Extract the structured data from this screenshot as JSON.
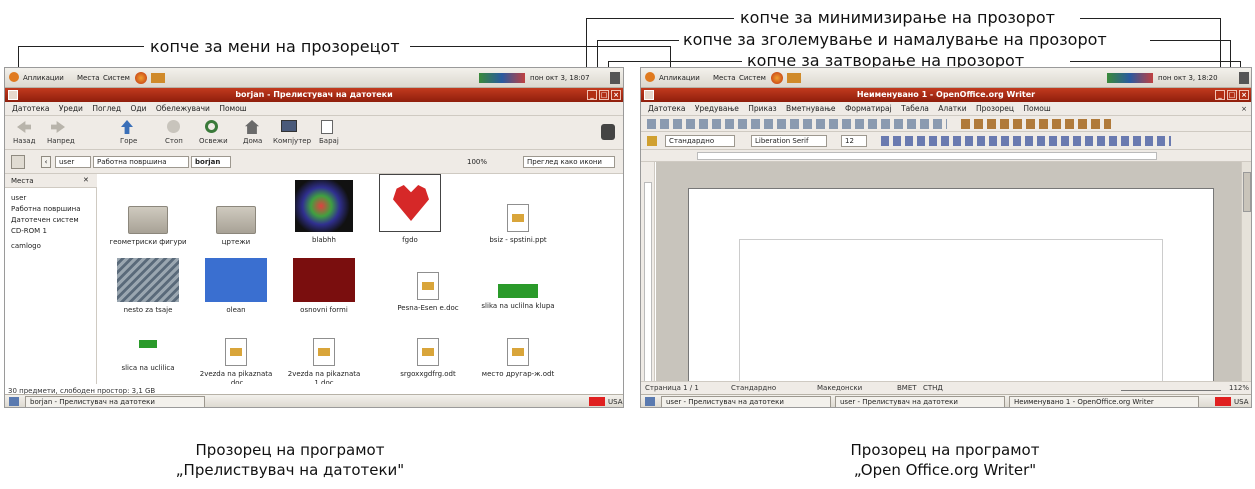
{
  "annotations": {
    "window_menu_button": "копче за мени на прозорецот",
    "minimize_button": "копче за минимизирање на прозорот",
    "maximize_button": "копче за зголемување и намалување на прозорот",
    "close_button": "копче за затворање на прозорот"
  },
  "captions": {
    "left_line1": "Прозорец на програмот",
    "left_line2": "„Прелиствувач на датотеки\"",
    "right_line1": "Прозорец на програмот",
    "right_line2": "„Open Office.org Writer\""
  },
  "gnome_panel": {
    "applications": "Апликации",
    "places": "Места",
    "system": "Систем",
    "clock": "пон окт 3, 18:07",
    "clock_right": "пон окт 3, 18:20"
  },
  "file_browser": {
    "title": "borjan - Прелистувач на датотеки",
    "menu": [
      "Датотека",
      "Уреди",
      "Поглед",
      "Оди",
      "Обележувачи",
      "Помош"
    ],
    "toolbar": [
      "Назад",
      "Напред",
      "Горе",
      "Стоп",
      "Освежи",
      "Дома",
      "Компјутер",
      "Барај"
    ],
    "path": [
      "user",
      "Работна површина",
      "borjan"
    ],
    "zoom": "100%",
    "view_mode": "Преглед како икони",
    "sidebar_header": "Места",
    "sidebar": [
      "user",
      "Работна површина",
      "Датотечен систем",
      "CD-ROM 1",
      "camlogo"
    ],
    "items": [
      {
        "name": "геометриски фигури",
        "type": "folder"
      },
      {
        "name": "цртежи",
        "type": "folder"
      },
      {
        "name": "blabhh",
        "type": "image"
      },
      {
        "name": "fgdo",
        "type": "heart"
      },
      {
        "name": "bsiz - spstini.ppt",
        "type": "doc"
      },
      {
        "name": "nesto za tsaje",
        "type": "solar"
      },
      {
        "name": "olean",
        "type": "blue"
      },
      {
        "name": "osnovni formi",
        "type": "darkred"
      },
      {
        "name": "Pesna-Esen e.doc",
        "type": "doc"
      },
      {
        "name": "slika na uclilna klupa",
        "type": "bench"
      },
      {
        "name": "slica na uclilica",
        "type": "smallbench"
      },
      {
        "name": "2vezda na pikaznata .doc",
        "type": "doc"
      },
      {
        "name": "2vezda na pikaznata 1.doc",
        "type": "doc"
      },
      {
        "name": "srgoxxgdfrg.odt",
        "type": "doc"
      },
      {
        "name": "место другар-ж.odt",
        "type": "doc"
      }
    ],
    "status": "30 предмети, слободен простор: 3,1 GB",
    "task": "borjan - Прелистувач на датотеки",
    "kbd": "USA"
  },
  "writer": {
    "title": "Неименувано 1 - OpenOffice.org Writer",
    "menu": [
      "Датотека",
      "Уредување",
      "Приказ",
      "Вметнување",
      "Форматирај",
      "Табела",
      "Алатки",
      "Прозорец",
      "Помош"
    ],
    "style": "Стандардно",
    "font": "Liberation Serif",
    "size": "12",
    "status": {
      "page": "Страница 1 / 1",
      "style": "Стандардно",
      "lang": "Македонски",
      "ins": "ВМЕТ",
      "std": "СТНД",
      "zoom": "112%"
    },
    "tasks": [
      "user - Прелистувач на датотеки",
      "user - Прелистувач на датотеки",
      "Неименувано 1 - OpenOffice.org Writer"
    ],
    "kbd": "USA"
  },
  "colors": {
    "titlebar": "#a82a13",
    "panel": "#e6e2da"
  }
}
